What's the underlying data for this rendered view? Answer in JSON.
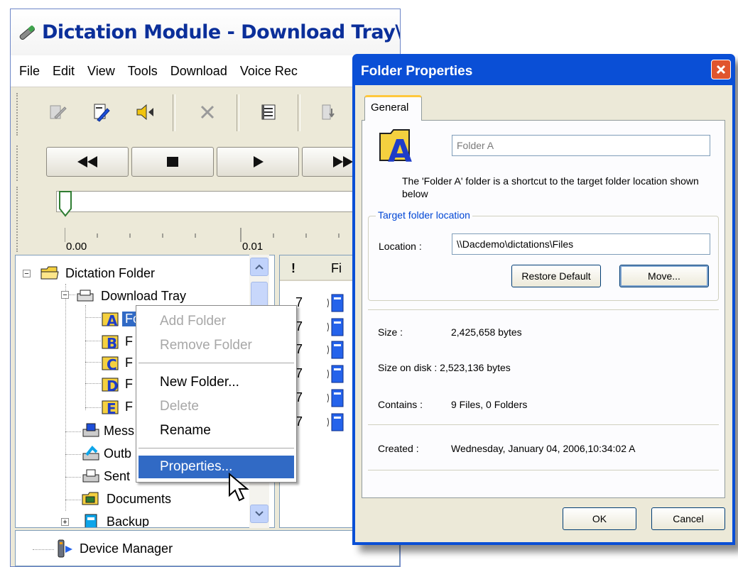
{
  "main_window": {
    "title": "Dictation Module - Download Tray\\Folder",
    "menu": [
      "File",
      "Edit",
      "View",
      "Tools",
      "Download",
      "Voice Rec"
    ],
    "ruler_labels": [
      "0.00",
      "0.01"
    ]
  },
  "tree": {
    "root": "Dictation Folder",
    "download_tray": "Download Tray",
    "selected_folder": "Folder A",
    "subfolder_letters": [
      "A",
      "B",
      "C",
      "D",
      "E"
    ],
    "subfolder_prefix": "F",
    "messages": "Mess",
    "outbox": "Outb",
    "sent": "Sent",
    "documents": "Documents",
    "backup": "Backup",
    "device_manager": "Device Manager"
  },
  "list": {
    "header_priority": "!",
    "header_file": "Fi",
    "row_values": [
      "7",
      "7",
      "7",
      "7",
      "7",
      "7"
    ]
  },
  "context_menu": {
    "add_folder": "Add Folder",
    "remove_folder": "Remove Folder",
    "new_folder": "New Folder...",
    "delete": "Delete",
    "rename": "Rename",
    "properties": "Properties..."
  },
  "dialog": {
    "title": "Folder Properties",
    "tab_general": "General",
    "folder_name_icon_letter": "A",
    "folder_name_value": "Folder A",
    "description": "The 'Folder A' folder is a shortcut to the target folder location shown below",
    "group_title": "Target folder location",
    "location_label": "Location :",
    "location_value": "\\\\Dacdemo\\dictations\\Files",
    "restore_default": "Restore Default",
    "move": "Move...",
    "size_label": "Size :",
    "size_value": "2,425,658 bytes",
    "size_on_disk": "Size on disk : 2,523,136 bytes",
    "contains_label": "Contains :",
    "contains_value": "9 Files, 0 Folders",
    "created_label": "Created :",
    "created_value": "Wednesday, January 04, 2006,10:34:02 A",
    "ok": "OK",
    "cancel": "Cancel"
  },
  "colors": {
    "xp_title_blue": "#0a4fd6",
    "selection_blue": "#316ac5",
    "window_face": "#ece9d8",
    "folder_yellow": "#f4d03f",
    "letter_blue": "#1e3cc8"
  }
}
